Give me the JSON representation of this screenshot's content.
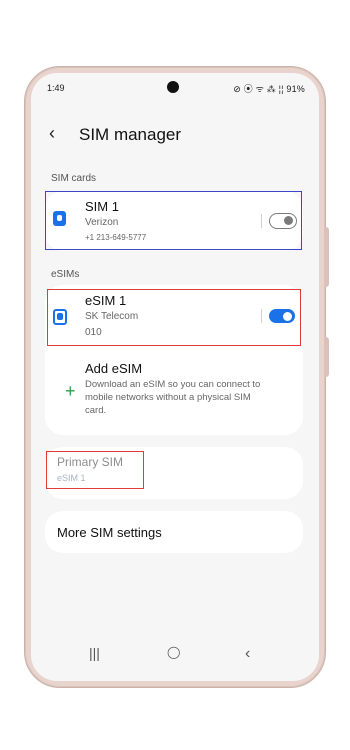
{
  "status_bar": {
    "time": "1:49",
    "right": "⊘ ⦿ ᯤ ⁂ ¦¦ 91%"
  },
  "header": {
    "back_icon": "←",
    "title": "SIM manager"
  },
  "sim_cards": {
    "label": "SIM cards",
    "sim1": {
      "name": "SIM 1",
      "carrier": "Verizon",
      "number": "+1 213-649-5777",
      "enabled": false
    }
  },
  "esims": {
    "label": "eSIMs",
    "esim1": {
      "name": "eSIM 1",
      "carrier": "SK Telecom",
      "number": "010",
      "enabled": true
    }
  },
  "add_esim": {
    "title": "Add eSIM",
    "desc_line1": "Download an eSIM so you can connect to",
    "desc_line2": "mobile networks without a physical SIM",
    "desc_line3": "card."
  },
  "primary_sim": {
    "title": "Primary SIM",
    "value": "eSIM 1"
  },
  "more_settings": {
    "label": "More SIM settings"
  },
  "nav": {
    "recents": "|||",
    "home": "◯",
    "back": "‹"
  },
  "colors": {
    "accent": "#1b72e8",
    "highlight_blue": "#3b47c9",
    "highlight_red": "#e13a3a",
    "plus_green": "#2aa24a"
  }
}
